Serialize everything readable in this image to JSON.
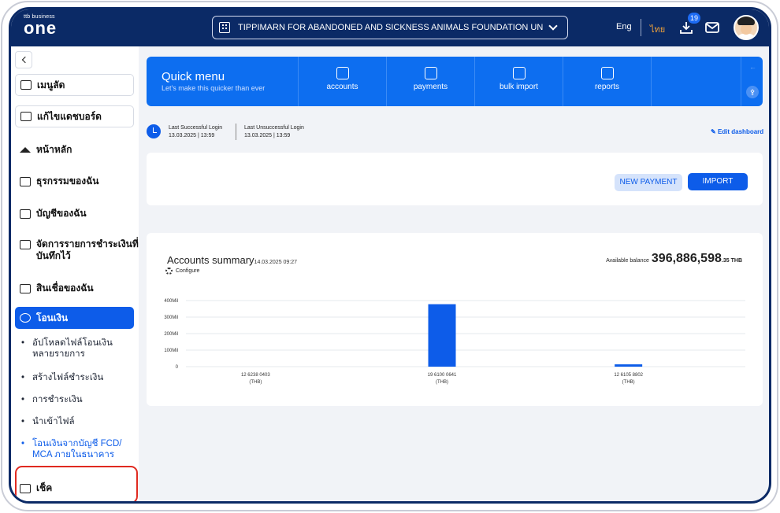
{
  "header": {
    "logo_small": "ttb business",
    "logo_big": "one",
    "organization": "TIPPIMARN FOR ABANDONED AND SICKNESS ANIMALS FOUNDATION UNDER T...",
    "lang_en": "Eng",
    "lang_th": "ไทย",
    "download_badge": "19"
  },
  "sidebar": {
    "items": [
      {
        "label": "เมนูลัด"
      },
      {
        "label": "แก้ไขแดชบอร์ด"
      },
      {
        "label": "หน้าหลัก"
      },
      {
        "label": "ธุรกรรมของฉัน"
      },
      {
        "label": "บัญชีของฉัน"
      },
      {
        "label": "จัดการรายการชำระเงินที่",
        "label2": "บันทึกไว้"
      },
      {
        "label": "สินเชื่อของฉัน"
      },
      {
        "label": "โอนเงิน"
      },
      {
        "label": "เช็ค"
      }
    ],
    "subitems": [
      {
        "line1": "อัปโหลดไฟล์โอนเงิน",
        "line2": "หลายรายการ"
      },
      {
        "line1": "สร้างไฟล์ชำระเงิน"
      },
      {
        "line1": "การชำระเงิน"
      },
      {
        "line1": "นำเข้าไฟล์"
      },
      {
        "line1": "โอนเงินจากบัญชี FCD/",
        "line2": "MCA ภายในธนาคาร"
      }
    ]
  },
  "quick_menu": {
    "title": "Quick menu",
    "subtitle": "Let's make this quicker than ever",
    "items": [
      {
        "label": "accounts",
        "icon": "accounts-icon"
      },
      {
        "label": "payments",
        "icon": "payments-icon"
      },
      {
        "label": "bulk import",
        "icon": "bulk-import-icon"
      },
      {
        "label": "reports",
        "icon": "reports-icon"
      }
    ]
  },
  "login": {
    "success_label": "Last Successful Login",
    "success_time": "13.03.2025 | 13:59",
    "fail_label": "Last Unsuccessful Login",
    "fail_time": "13.03.2025 | 13:59",
    "edit_label": "Edit dashboard"
  },
  "actions": {
    "new_payment": "NEW PAYMENT",
    "import": "IMPORT"
  },
  "accounts": {
    "title": "Accounts summary",
    "date": "14.03.2025 09:27",
    "configure": "Configure",
    "balance_label": "Available balance",
    "balance_main": "396,886,598",
    "balance_decimals": ".35",
    "balance_currency": "THB"
  },
  "chart_data": {
    "type": "bar",
    "categories": [
      "12 6238 0403 (THB)",
      "19 6100 0641 (THB)",
      "12 6105 8802 (THB)"
    ],
    "category_lines": [
      [
        "12 6238 0403",
        "(THB)"
      ],
      [
        "19 6100 0641",
        "(THB)"
      ],
      [
        "12 6105 8802",
        "(THB)"
      ]
    ],
    "values": [
      0,
      378000000,
      14000000
    ],
    "yticks": [
      "0",
      "100Mil",
      "200Mil",
      "300Mil",
      "400Mil"
    ],
    "ylim": [
      0,
      400000000
    ],
    "grid": true,
    "color": "#0d5ce9"
  }
}
